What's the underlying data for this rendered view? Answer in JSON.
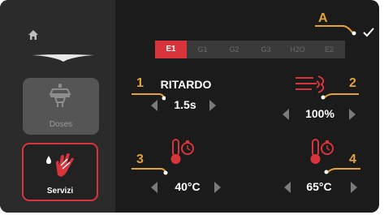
{
  "sidebar": {
    "doses_label": "Doses",
    "servizi_label": "Servizi"
  },
  "tabs": [
    "E1",
    "G1",
    "G2",
    "G3",
    "H2O",
    "E2"
  ],
  "active_tab": "E1",
  "annotations": {
    "a": "A",
    "one": "1",
    "two": "2",
    "three": "3",
    "four": "4"
  },
  "params": {
    "ritardo": {
      "title": "RITARDO",
      "value": "1.5s"
    },
    "fan": {
      "value": "100%"
    },
    "temp1": {
      "value": "40°C"
    },
    "temp2": {
      "value": "65°C"
    }
  },
  "colors": {
    "accent": "#d7343c",
    "annotation": "#e4a33a",
    "background": "#1b1b1b",
    "sidebar": "#2b2b2b"
  },
  "icons": [
    "home-icon",
    "portafilter-icon",
    "hand-drop-icon",
    "check-icon",
    "fan-heat-icon",
    "thermometer-timer-icon"
  ]
}
